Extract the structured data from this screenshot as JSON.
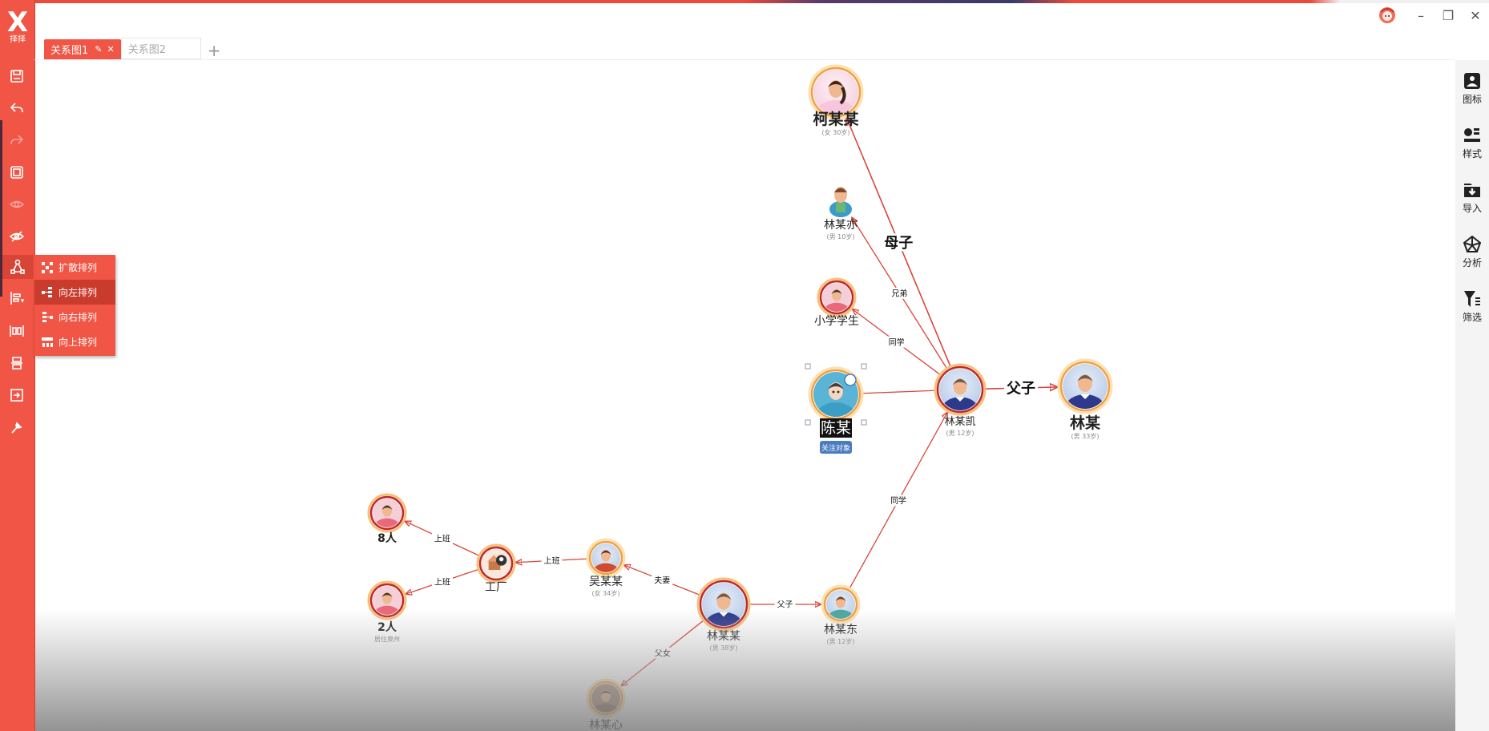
{
  "app": {
    "logo_glyph": "X",
    "logo_text": "择择"
  },
  "tabs": [
    {
      "label": "关系图1",
      "active": true,
      "edit_icon": "✎",
      "close_icon": "✕"
    },
    {
      "label": "关系图2",
      "active": false
    }
  ],
  "add_tab": "+",
  "window_controls": {
    "avatar_icon": "support-avatar",
    "minimize": "–",
    "restore": "❐",
    "close": "✕"
  },
  "left_toolbar": [
    {
      "name": "save",
      "enabled": true
    },
    {
      "name": "undo",
      "enabled": true
    },
    {
      "name": "redo",
      "enabled": false
    },
    {
      "name": "fit-frame",
      "enabled": true
    },
    {
      "name": "show",
      "enabled": false
    },
    {
      "name": "hide",
      "enabled": true
    },
    {
      "name": "layout-tree",
      "enabled": true,
      "active": true
    },
    {
      "name": "align-left",
      "enabled": true
    },
    {
      "name": "distribute-horizontal",
      "enabled": true
    },
    {
      "name": "distribute-vertical",
      "enabled": true
    },
    {
      "name": "export",
      "enabled": true
    },
    {
      "name": "pin",
      "enabled": true
    }
  ],
  "layout_menu": [
    {
      "label": "扩散排列",
      "icon": "spread-icon"
    },
    {
      "label": "向左排列",
      "icon": "left-layout-icon",
      "hover": true
    },
    {
      "label": "向右排列",
      "icon": "right-layout-icon"
    },
    {
      "label": "向上排列",
      "icon": "up-layout-icon"
    }
  ],
  "right_panel": [
    {
      "label": "图标",
      "icon": "image-icon"
    },
    {
      "label": "样式",
      "icon": "style-icon"
    },
    {
      "label": "导入",
      "icon": "import-folder-icon"
    },
    {
      "label": "分析",
      "icon": "analysis-icon"
    },
    {
      "label": "筛选",
      "icon": "filter-icon"
    }
  ],
  "graph": {
    "nodes": [
      {
        "id": "kemoumou",
        "name": "柯某某",
        "sub": "(女 30岁)",
        "avatar": "woman",
        "ring": "#f0a040",
        "big": true
      },
      {
        "id": "linmouyi",
        "name": "林某亦",
        "sub": "(男 10岁)",
        "avatar": "boy-plain",
        "ring": "none"
      },
      {
        "id": "xiaoxue",
        "name": "小学学生",
        "sub": "",
        "avatar": "girl",
        "ring": "#c0282a"
      },
      {
        "id": "chenmou",
        "name": "陈某",
        "sub": "",
        "badge": "关注对象",
        "avatar": "cartoon-man",
        "ring": "#f0a040",
        "selected": true,
        "big": true
      },
      {
        "id": "linmoukai",
        "name": "林某凯",
        "sub": "(男 12岁)",
        "avatar": "man",
        "ring": "#c0282a"
      },
      {
        "id": "linmou",
        "name": "林某",
        "sub": "(男 33岁)",
        "avatar": "man",
        "ring": "#f0a040",
        "big": true
      },
      {
        "id": "ba_ren",
        "name": "8人",
        "sub": "",
        "avatar": "girl",
        "ring": "#c0282a"
      },
      {
        "id": "gongchang",
        "name": "工厂",
        "sub": "",
        "avatar": "factory",
        "ring": "#c0282a"
      },
      {
        "id": "wumoumou",
        "name": "吴某某",
        "sub": "(女 34岁)",
        "avatar": "woman-red",
        "ring": "#f0a040"
      },
      {
        "id": "linmoumou",
        "name": "林某某",
        "sub": "(男 38岁)",
        "avatar": "man",
        "ring": "#c0282a"
      },
      {
        "id": "linmoudong",
        "name": "林某东",
        "sub": "(男 12岁)",
        "avatar": "boy",
        "ring": "#f0a040"
      },
      {
        "id": "er_ren",
        "name": "2人",
        "sub": "居住泉州",
        "avatar": "girl",
        "ring": "#c0282a"
      },
      {
        "id": "linmouxin",
        "name": "林某心",
        "sub": "",
        "avatar": "girl-dark",
        "ring": "#f0a040"
      }
    ],
    "edges": [
      {
        "from": "linmoukai",
        "to": "kemoumou",
        "label": "母子",
        "big": true
      },
      {
        "from": "linmoukai",
        "to": "linmouyi",
        "label": "兄弟"
      },
      {
        "from": "linmoukai",
        "to": "xiaoxue",
        "label": "同学"
      },
      {
        "from": "chenmou",
        "to": "linmoukai",
        "label": "",
        "arrow": false
      },
      {
        "from": "linmoukai",
        "to": "linmou",
        "label": "父子",
        "big": true
      },
      {
        "from": "linmoudong",
        "to": "linmoukai",
        "label": "同学"
      },
      {
        "from": "gongchang",
        "to": "ba_ren",
        "label": "上班"
      },
      {
        "from": "gongchang",
        "to": "er_ren",
        "label": "上班"
      },
      {
        "from": "wumoumou",
        "to": "gongchang",
        "label": "上班"
      },
      {
        "from": "linmoumou",
        "to": "wumoumou",
        "label": "夫妻"
      },
      {
        "from": "linmoumou",
        "to": "linmoudong",
        "label": "父子"
      },
      {
        "from": "linmoumou",
        "to": "linmouxin",
        "label": "父女"
      }
    ]
  },
  "colors": {
    "accent": "#f05545",
    "edge": "#d9453a",
    "badge": "#4a7cc0"
  }
}
